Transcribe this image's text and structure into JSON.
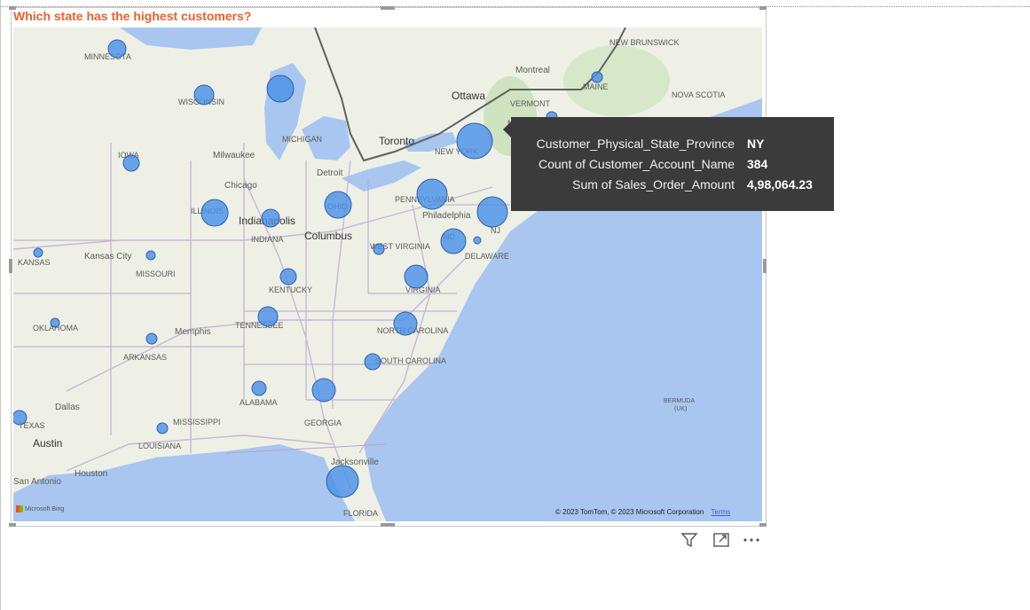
{
  "visual": {
    "title": "Which state has the highest customers?"
  },
  "map": {
    "attribution": "© 2023 TomTom, © 2023 Microsoft Corporation",
    "terms_label": "Terms",
    "provider_label": "Microsoft Bing",
    "bubble_color": "#4a90e8",
    "labels": [
      "MINNESOTA",
      "WISCONSIN",
      "IOWA",
      "MICHIGAN",
      "Milwaukee",
      "Chicago",
      "Detroit",
      "Toronto",
      "Ottawa",
      "Montreal",
      "NEW BRUNSWICK",
      "MAINE",
      "NOVA SCOTIA",
      "VERMONT",
      "NEW HAMPSHIRE",
      "NEW YORK",
      "New York",
      "PENNSYLVANIA",
      "Philadelphia",
      "NJ",
      "MD",
      "DELAWARE",
      "OHIO",
      "Columbus",
      "ILLINOIS",
      "Indianapolis",
      "INDIANA",
      "Kansas City",
      "MISSOURI",
      "KANSAS",
      "WEST VIRGINIA",
      "VIRGINIA",
      "KENTUCKY",
      "TENNESSEE",
      "Memphis",
      "ARKANSAS",
      "OKLAHOMA",
      "NORTH CAROLINA",
      "SOUTH CAROLINA",
      "ALABAMA",
      "GEORGIA",
      "MISSISSIPPI",
      "LOUISIANA",
      "Dallas",
      "TEXAS",
      "Austin",
      "Houston",
      "San Antonio",
      "Jacksonville",
      "FLORIDA",
      "BERMUDA",
      "(UK)"
    ]
  },
  "tooltip": {
    "rows": [
      {
        "label": "Customer_Physical_State_Province",
        "value": "NY"
      },
      {
        "label": "Count of Customer_Account_Name",
        "value": "384"
      },
      {
        "label": "Sum of Sales_Order_Amount",
        "value": "4,98,064.23"
      }
    ]
  },
  "toolbar": {
    "filter_icon": "filter-icon",
    "focus_icon": "focus-mode-icon",
    "more_icon": "more-options-icon"
  }
}
